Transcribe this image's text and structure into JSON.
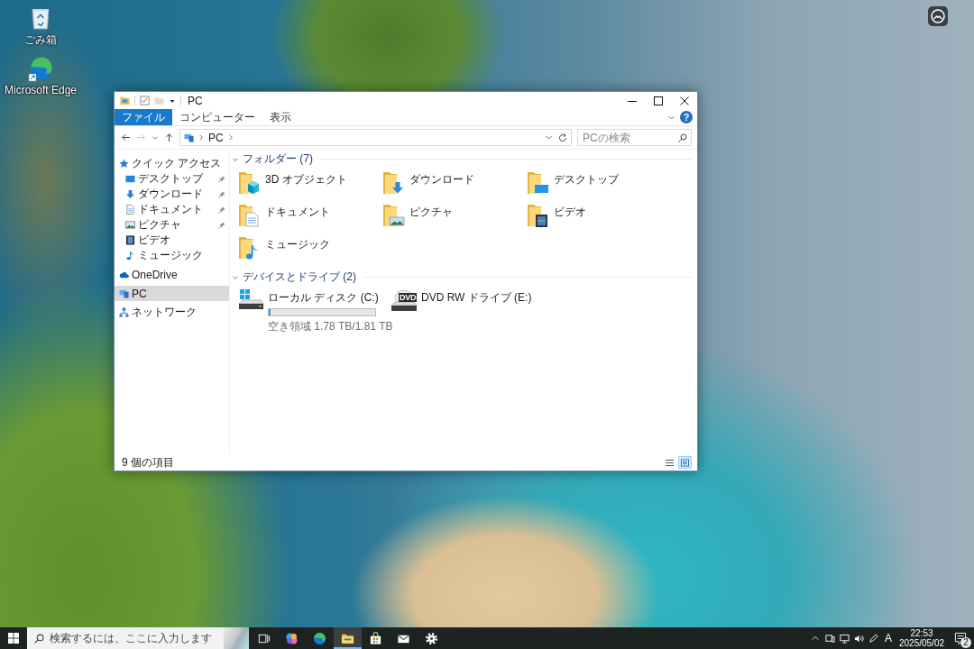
{
  "desktop_icons": [
    {
      "label": "ごみ箱",
      "kind": "recycle_bin"
    },
    {
      "label": "Microsoft Edge",
      "kind": "edge"
    }
  ],
  "window": {
    "title": "PC",
    "ribbon_tabs": [
      {
        "label": "ファイル",
        "kind": "menu"
      },
      {
        "label": "コンピューター",
        "kind": "tab"
      },
      {
        "label": "表示",
        "kind": "tab"
      }
    ],
    "help_label": "?",
    "address": {
      "path": [
        "PC"
      ]
    },
    "search": {
      "placeholder": "PCの検索"
    },
    "nav": [
      {
        "label": "クイック アクセス",
        "kind": "quick_access",
        "selected": false,
        "children": [
          {
            "label": "デスクトップ",
            "kind": "desktop",
            "pinned": true,
            "selected": false
          },
          {
            "label": "ダウンロード",
            "kind": "download",
            "pinned": true,
            "selected": false
          },
          {
            "label": "ドキュメント",
            "kind": "documents",
            "pinned": true,
            "selected": false
          },
          {
            "label": "ピクチャ",
            "kind": "pictures",
            "pinned": true,
            "selected": false
          },
          {
            "label": "ビデオ",
            "kind": "videos",
            "pinned": false,
            "selected": false
          },
          {
            "label": "ミュージック",
            "kind": "music",
            "pinned": false,
            "selected": false
          }
        ]
      },
      {
        "label": "OneDrive",
        "kind": "onedrive",
        "selected": false
      },
      {
        "label": "PC",
        "kind": "pc",
        "selected": true
      },
      {
        "label": "ネットワーク",
        "kind": "network",
        "selected": false
      }
    ],
    "groups": [
      {
        "title": "フォルダー (7)",
        "kind": "folders",
        "expanded": true,
        "items": [
          {
            "label": "3D オブジェクト",
            "kind": "objects"
          },
          {
            "label": "ダウンロード",
            "kind": "download"
          },
          {
            "label": "デスクトップ",
            "kind": "desktop"
          },
          {
            "label": "ドキュメント",
            "kind": "documents"
          },
          {
            "label": "ピクチャ",
            "kind": "pictures"
          },
          {
            "label": "ビデオ",
            "kind": "videos"
          },
          {
            "label": "ミュージック",
            "kind": "music"
          }
        ]
      },
      {
        "title": "デバイスとドライブ (2)",
        "kind": "drives",
        "expanded": true,
        "items": [
          {
            "label": "ローカル ディスク (C:)",
            "kind": "hdd",
            "level": 0.02,
            "free": "空き領域 1.78 TB/1.81 TB"
          },
          {
            "label": "DVD RW ドライブ (E:)",
            "kind": "dvd",
            "disc_label": "DVD"
          }
        ]
      }
    ],
    "status": {
      "count": "9 個の項目",
      "views": [
        {
          "kind": "details",
          "selected": false
        },
        {
          "kind": "large_icons",
          "selected": true
        }
      ]
    }
  },
  "taskbar": {
    "search_placeholder": "検索するには、ここに入力します",
    "apps": [
      {
        "kind": "task_view",
        "selected": false
      },
      {
        "kind": "copilot",
        "selected": false
      },
      {
        "kind": "edge",
        "selected": false
      },
      {
        "kind": "explorer",
        "selected": true
      },
      {
        "kind": "store",
        "selected": false
      },
      {
        "kind": "mail",
        "selected": false
      },
      {
        "kind": "settings",
        "selected": false
      }
    ],
    "tray": {
      "ime": "A",
      "time": "22:53",
      "date": "2025/05/02",
      "notification_count": "2"
    }
  }
}
